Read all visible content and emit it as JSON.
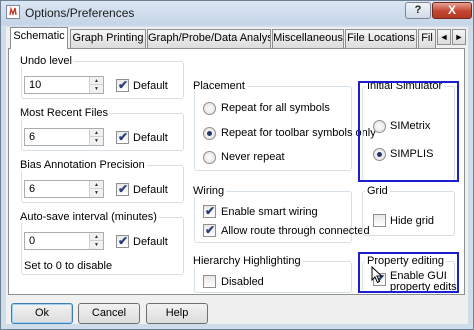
{
  "window": {
    "title": "Options/Preferences",
    "help_label": "?",
    "close_label": "X"
  },
  "icons": {
    "app": "simetrix-app-icon",
    "close": "close-icon",
    "help": "help-icon",
    "cursor": "mouse-cursor-icon"
  },
  "tabs": [
    {
      "label": "Schematic",
      "active": true
    },
    {
      "label": "Graph Printing"
    },
    {
      "label": "Graph/Probe/Data Analysis"
    },
    {
      "label": "Miscellaneous"
    },
    {
      "label": "File Locations"
    },
    {
      "label": "Fil"
    }
  ],
  "tab_scroll": {
    "left": "◄",
    "right": "►"
  },
  "undo": {
    "label": "Undo level",
    "value": "10",
    "default_label": "Default",
    "default_checked": true
  },
  "recent": {
    "label": "Most Recent Files",
    "value": "6",
    "default_label": "Default",
    "default_checked": true
  },
  "bias": {
    "label": "Bias Annotation Precision",
    "value": "6",
    "default_label": "Default",
    "default_checked": true
  },
  "autosave": {
    "label": "Auto-save interval (minutes)",
    "value": "0",
    "default_label": "Default",
    "default_checked": true,
    "note": "Set to 0 to disable"
  },
  "placement": {
    "label": "Placement",
    "options": [
      {
        "label": "Repeat for all symbols",
        "selected": false
      },
      {
        "label": "Repeat for toolbar symbols only",
        "selected": true
      },
      {
        "label": "Never repeat",
        "selected": false
      }
    ]
  },
  "wiring": {
    "label": "Wiring",
    "options": [
      {
        "label": "Enable smart wiring",
        "checked": true
      },
      {
        "label": "Allow route through connected",
        "checked": true
      }
    ]
  },
  "hierarchy": {
    "label": "Hierarchy Highlighting",
    "option": "Disabled",
    "checked": false
  },
  "simulator": {
    "label": "Initial Simulator",
    "options": [
      {
        "label": "SIMetrix",
        "selected": false
      },
      {
        "label": "SIMPLIS",
        "selected": true
      }
    ]
  },
  "grid": {
    "label": "Grid",
    "option": "Hide grid",
    "checked": false
  },
  "property": {
    "label": "Property editing",
    "option_line1": "Enable GUI",
    "option_line2": "property edits",
    "checked": true
  },
  "buttons": {
    "ok": "Ok",
    "cancel": "Cancel",
    "help": "Help"
  },
  "colors": {
    "highlight": "#1c1ecf",
    "close": "#c2452f",
    "titlebar": "#cfdcea"
  }
}
